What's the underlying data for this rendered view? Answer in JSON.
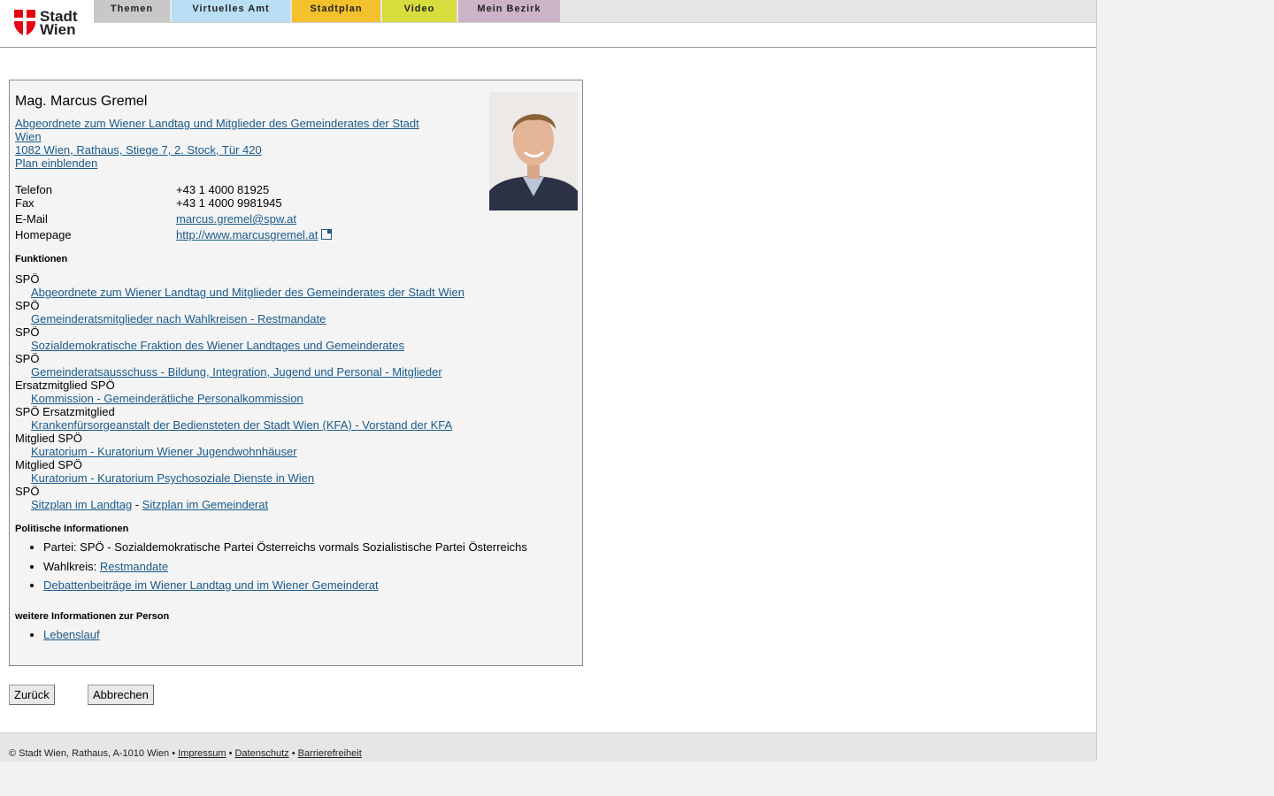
{
  "logo": {
    "line1": "Stadt",
    "line2": "Wien"
  },
  "nav": [
    {
      "label": "Themen"
    },
    {
      "label": "Virtuelles Amt"
    },
    {
      "label": "Stadtplan"
    },
    {
      "label": "Video"
    },
    {
      "label": "Mein Bezirk"
    }
  ],
  "person": {
    "name": "Mag. Marcus Gremel",
    "org_link_line1": "Abgeordnete zum Wiener Landtag und Mitglieder des Gemeinderates der Stadt",
    "org_link_line2": "Wien ",
    "address": "1082 Wien, Rathaus, Stiege 7, 2. Stock, Tür 420",
    "plan_link": "Plan einblenden"
  },
  "contact": [
    {
      "label": "Telefon",
      "value": "+43 1 4000 81925"
    },
    {
      "label": "Fax",
      "value": "+43 1 4000 9981945"
    },
    {
      "label": "E-Mail",
      "value": "marcus.gremel@spw.at"
    },
    {
      "label": "Homepage",
      "value": "http://www.marcusgremel.at"
    }
  ],
  "functions_title": "Funktionen",
  "functions": [
    {
      "party": "SPÖ",
      "role": "Abgeordnete zum Wiener Landtag und Mitglieder des Gemeinderates der Stadt Wien"
    },
    {
      "party": "SPÖ",
      "role": "Gemeinderatsmitglieder nach Wahlkreisen - Restmandate"
    },
    {
      "party": "SPÖ",
      "role": "Sozialdemokratische Fraktion des Wiener Landtages und Gemeinderates"
    },
    {
      "party": "SPÖ",
      "role": "Gemeinderatsausschuss - Bildung, Integration, Jugend und Personal - Mitglieder"
    },
    {
      "party": "Ersatzmitglied SPÖ",
      "role": "Kommission - Gemeinderätliche Personalkommission"
    },
    {
      "party": "SPÖ Ersatzmitglied",
      "role": "Krankenfürsorgeanstalt der Bediensteten der Stadt Wien (KFA) - Vorstand der KFA"
    },
    {
      "party": "Mitglied SPÖ",
      "role": "Kuratorium - Kuratorium Wiener Jugendwohnhäuser"
    },
    {
      "party": "Mitglied SPÖ",
      "role": "Kuratorium - Kuratorium Psychosoziale Dienste in Wien"
    }
  ],
  "seating": {
    "party": "SPÖ",
    "link1": "Sitzplan im Landtag",
    "separator": " - ",
    "link2": "Sitzplan im Gemeinderat"
  },
  "political_title": "Politische Informationen",
  "political": {
    "party_text": "Partei: SPÖ - Sozialdemokratische Partei Österreichs vormals Sozialistische Partei Österreichs",
    "wahlkreis_label": "Wahlkreis: ",
    "wahlkreis_link": "Restmandate",
    "debates_link": "Debattenbeiträge im Wiener Landtag und im Wiener Gemeinderat"
  },
  "more_title": "weitere Informationen zur Person",
  "more": {
    "cv_link": "Lebenslauf"
  },
  "buttons": {
    "back": "Zurück",
    "cancel": "Abbrechen"
  },
  "footer": {
    "text": "© Stadt Wien, Rathaus, A-1010 Wien • ",
    "impressum": "Impressum",
    "sep1": " • ",
    "datenschutz": "Datenschutz",
    "sep2": " • ",
    "barrierefreiheit": "Barrierefreiheit"
  }
}
